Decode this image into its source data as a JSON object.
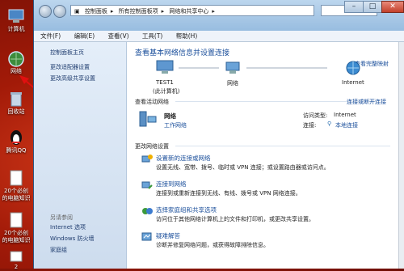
{
  "desktop": {
    "icons": [
      {
        "label": "计算机"
      },
      {
        "label": "网络"
      },
      {
        "label": "回收站"
      },
      {
        "label": "腾讯QQ"
      },
      {
        "label": "20个必创的电脑知识"
      },
      {
        "label": "20个必创的电脑知识"
      },
      {
        "label": "2"
      }
    ]
  },
  "addressbar": {
    "crumbs": [
      "控制面板",
      "所有控制面板项",
      "网络和共享中心"
    ]
  },
  "menubar": {
    "items": [
      "文件(F)",
      "编辑(E)",
      "查看(V)",
      "工具(T)",
      "帮助(H)"
    ]
  },
  "sidebar": {
    "links": [
      "控制面板主页",
      "更改适配器设置",
      "更改高级共享设置"
    ],
    "see_also_label": "另请参阅",
    "see_also": [
      "Internet 选项",
      "Windows 防火墙",
      "家庭组"
    ]
  },
  "main": {
    "heading": "查看基本网络信息并设置连接",
    "full_map_link": "查看完整映射",
    "nodes": [
      {
        "label": "TEST1",
        "sublabel": "(此计算机)"
      },
      {
        "label": "网络"
      },
      {
        "label": "Internet"
      }
    ],
    "active_label": "查看活动网络",
    "connect_link": "连接或断开连接",
    "network_name": "网络",
    "network_type": "工作网络",
    "access_type_label": "访问类型:",
    "access_type_value": "Internet",
    "connection_label": "连接:",
    "connection_value": "本地连接",
    "change_label": "更改网络设置",
    "tasks": [
      {
        "title": "设置新的连接或网络",
        "desc": "设置无线、宽带、拨号、临时或 VPN 连接；或设置路由器或访问点。"
      },
      {
        "title": "连接到网络",
        "desc": "连接到或重新连接到无线、有线、拨号或 VPN 网络连接。"
      },
      {
        "title": "选择家庭组和共享选项",
        "desc": "访问位于其他网络计算机上的文件和打印机，或更改共享设置。"
      },
      {
        "title": "疑难解答",
        "desc": "诊断并修复网络问题，或获得故障排除信息。"
      }
    ]
  }
}
